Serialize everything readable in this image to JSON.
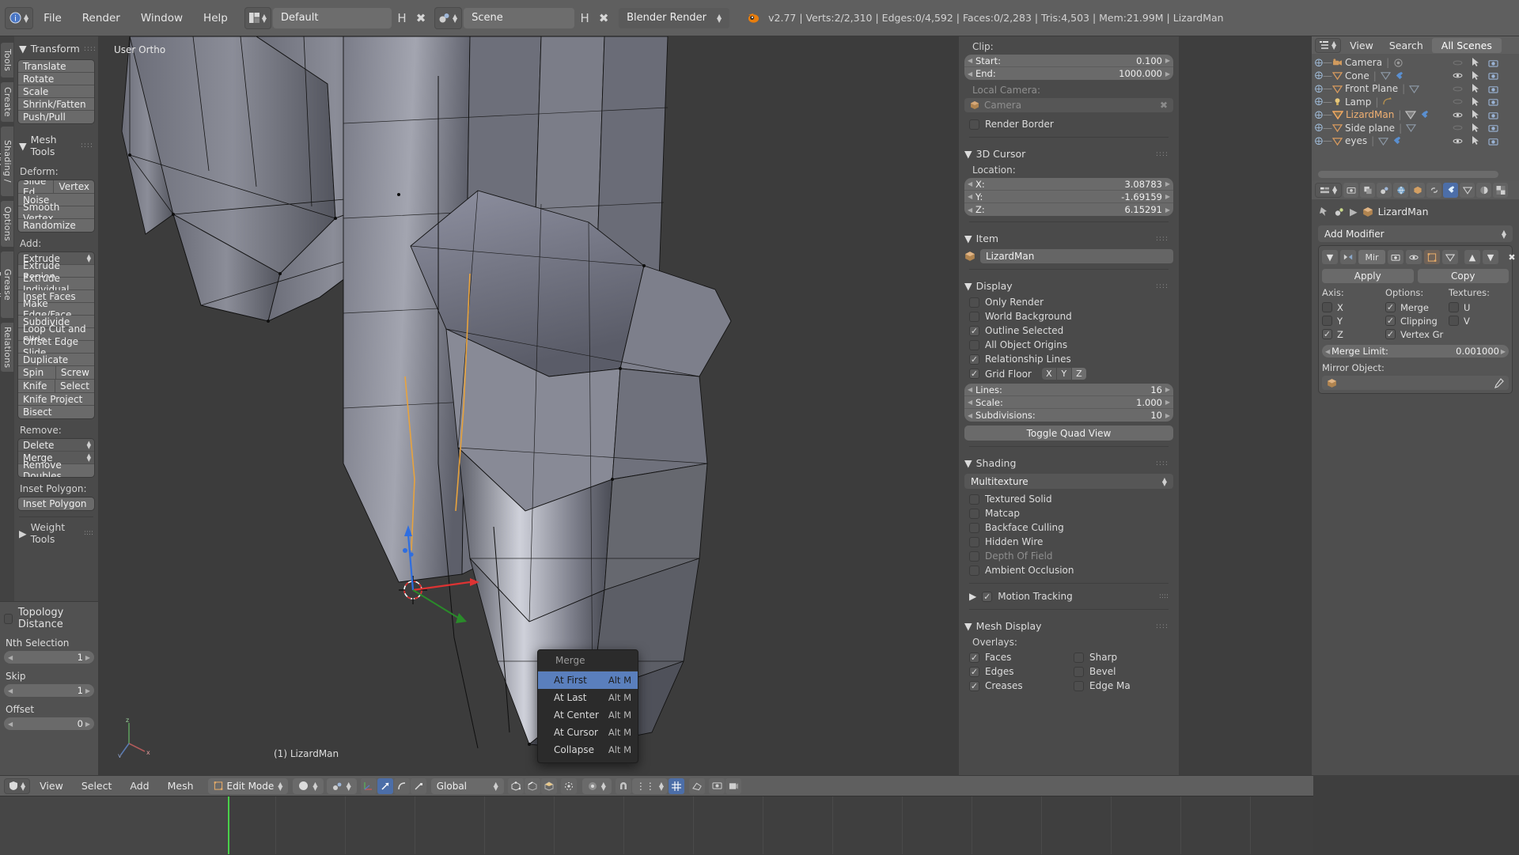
{
  "topbar": {
    "menus": [
      "File",
      "Render",
      "Window",
      "Help"
    ],
    "screen_layout": "Default",
    "scene_name": "Scene",
    "render_engine": "Blender Render",
    "status": "v2.77 | Verts:2/2,310 | Edges:0/4,592 | Faces:0/2,283 | Tris:4,503 | Mem:21.99M | LizardMan"
  },
  "toolshelf": {
    "tabs": [
      "Tools",
      "Create",
      "Shading / UVs",
      "Options",
      "Grease Pencil",
      "Relations"
    ],
    "active_tab": "Tools",
    "transform": {
      "title": "Transform",
      "buttons": [
        "Translate",
        "Rotate",
        "Scale",
        "Shrink/Fatten",
        "Push/Pull"
      ]
    },
    "mesh_tools": {
      "title": "Mesh Tools",
      "deform_label": "Deform:",
      "deform_row": [
        "Slide Ed",
        "Vertex"
      ],
      "deform_buttons": [
        "Noise",
        "Smooth Vertex",
        "Randomize"
      ],
      "add_label": "Add:",
      "add_dropdown": "Extrude",
      "add_buttons": [
        "Extrude Region",
        "Extrude Individual",
        "Inset Faces",
        "Make Edge/Face",
        "Subdivide",
        "Loop Cut and Slide",
        "Offset Edge Slide",
        "Duplicate"
      ],
      "add_row1": [
        "Spin",
        "Screw"
      ],
      "add_row2": [
        "Knife",
        "Select"
      ],
      "add_buttons2": [
        "Knife Project",
        "Bisect"
      ],
      "remove_label": "Remove:",
      "remove_dropdowns": [
        "Delete",
        "Merge"
      ],
      "remove_buttons": [
        "Remove Doubles"
      ],
      "inset_label": "Inset Polygon:",
      "inset_buttons": [
        "Inset Polygon"
      ],
      "weight_tools": "Weight Tools"
    }
  },
  "operator_panel": {
    "topology_distance": "Topology Distance",
    "fields": [
      {
        "label": "Nth Selection",
        "value": "1"
      },
      {
        "label": "Skip",
        "value": "1"
      },
      {
        "label": "Offset",
        "value": "0"
      }
    ]
  },
  "viewport": {
    "view_label": "User Ortho",
    "object_label": "(1) LizardMan",
    "axis_x": "x",
    "axis_y": "y",
    "axis_z": "z"
  },
  "merge_menu": {
    "title": "Merge",
    "items": [
      {
        "label": "At First",
        "shortcut": "Alt M",
        "selected": true
      },
      {
        "label": "At Last",
        "shortcut": "Alt M",
        "selected": false
      },
      {
        "label": "At Center",
        "shortcut": "Alt M",
        "selected": false
      },
      {
        "label": "At Cursor",
        "shortcut": "Alt M",
        "selected": false
      },
      {
        "label": "Collapse",
        "shortcut": "Alt M",
        "selected": false
      }
    ],
    "highlight_color": "#5a7fbd"
  },
  "view_panel": {
    "clip_label": "Clip:",
    "clip_start_label": "Start:",
    "clip_start_value": "0.100",
    "clip_end_label": "End:",
    "clip_end_value": "1000.000",
    "local_camera_label": "Local Camera:",
    "local_camera_value": "Camera",
    "render_border": "Render Border",
    "cursor_title": "3D Cursor",
    "location_label": "Location:",
    "cursor": [
      {
        "label": "X:",
        "value": "3.08783"
      },
      {
        "label": "Y:",
        "value": "-1.69159"
      },
      {
        "label": "Z:",
        "value": "6.15291"
      }
    ],
    "item_title": "Item",
    "item_name": "LizardMan",
    "display_title": "Display",
    "display_checks": [
      {
        "label": "Only Render",
        "checked": false
      },
      {
        "label": "World Background",
        "checked": false
      },
      {
        "label": "Outline Selected",
        "checked": true
      },
      {
        "label": "All Object Origins",
        "checked": false
      },
      {
        "label": "Relationship Lines",
        "checked": true
      }
    ],
    "grid_floor": {
      "label": "Grid Floor",
      "checked": true,
      "axes": [
        "X",
        "Y",
        "Z"
      ],
      "active_axis": "Z"
    },
    "grid_fields": [
      {
        "label": "Lines:",
        "value": "16"
      },
      {
        "label": "Scale:",
        "value": "1.000"
      },
      {
        "label": "Subdivisions:",
        "value": "10"
      }
    ],
    "toggle_quad_view": "Toggle Quad View",
    "shading_title": "Shading",
    "shading_mode": "Multitexture",
    "shading_checks": [
      {
        "label": "Textured Solid",
        "checked": false,
        "dim": false
      },
      {
        "label": "Matcap",
        "checked": false,
        "dim": false
      },
      {
        "label": "Backface Culling",
        "checked": false,
        "dim": false
      },
      {
        "label": "Hidden Wire",
        "checked": false,
        "dim": false
      },
      {
        "label": "Depth Of Field",
        "checked": false,
        "dim": true
      },
      {
        "label": "Ambient Occlusion",
        "checked": false,
        "dim": false
      }
    ],
    "motion_tracking": {
      "label": "Motion Tracking",
      "checked": true
    },
    "mesh_display_title": "Mesh Display",
    "overlays_label": "Overlays:",
    "overlays": [
      {
        "label": "Faces",
        "checked": true
      },
      {
        "label": "Sharp",
        "checked": false
      },
      {
        "label": "Edges",
        "checked": true
      },
      {
        "label": "Bevel",
        "checked": false
      },
      {
        "label": "Creases",
        "checked": true
      },
      {
        "label": "Edge Ma",
        "checked": false
      }
    ]
  },
  "outliner": {
    "menus": [
      "View",
      "Search"
    ],
    "display_mode": "All Scenes",
    "rows": [
      {
        "name": "Camera",
        "type": "camera",
        "selected": false,
        "visible": false,
        "has_modifier": false,
        "extra": "data"
      },
      {
        "name": "Cone",
        "type": "mesh",
        "selected": false,
        "visible": true,
        "has_modifier": true,
        "extra": "mesh"
      },
      {
        "name": "Front Plane",
        "type": "mesh",
        "selected": false,
        "visible": false,
        "has_modifier": false,
        "extra": "mesh"
      },
      {
        "name": "Lamp",
        "type": "lamp",
        "selected": false,
        "visible": false,
        "has_modifier": false,
        "extra": "lamp"
      },
      {
        "name": "LizardMan",
        "type": "mesh",
        "selected": true,
        "visible": true,
        "has_modifier": true,
        "extra": "mesh"
      },
      {
        "name": "Side plane",
        "type": "mesh",
        "selected": false,
        "visible": false,
        "has_modifier": false,
        "extra": "mesh"
      },
      {
        "name": "eyes",
        "type": "mesh",
        "selected": false,
        "visible": true,
        "has_modifier": true,
        "extra": "mesh"
      }
    ]
  },
  "properties": {
    "breadcrumb_object": "LizardMan",
    "add_modifier": "Add Modifier",
    "modifier_name": "Mir",
    "apply_label": "Apply",
    "copy_label": "Copy",
    "axis_label": "Axis:",
    "options_label": "Options:",
    "textures_label": "Textures:",
    "axis_checks": [
      {
        "label": "X",
        "checked": false
      },
      {
        "label": "Y",
        "checked": false
      },
      {
        "label": "Z",
        "checked": true
      }
    ],
    "option_checks": [
      {
        "label": "Merge",
        "checked": true
      },
      {
        "label": "Clipping",
        "checked": true
      },
      {
        "label": "Vertex Gr",
        "checked": true
      }
    ],
    "texture_checks": [
      {
        "label": "U",
        "checked": false
      },
      {
        "label": "V",
        "checked": false
      }
    ],
    "merge_limit_label": "Merge Limit:",
    "merge_limit_value": "0.001000",
    "mirror_object_label": "Mirror Object:",
    "mirror_object_value": "",
    "active_tab_index": 6
  },
  "bottombar": {
    "menus": [
      "View",
      "Select",
      "Add",
      "Mesh"
    ],
    "mode": "Edit Mode",
    "transform_orientation": "Global"
  }
}
